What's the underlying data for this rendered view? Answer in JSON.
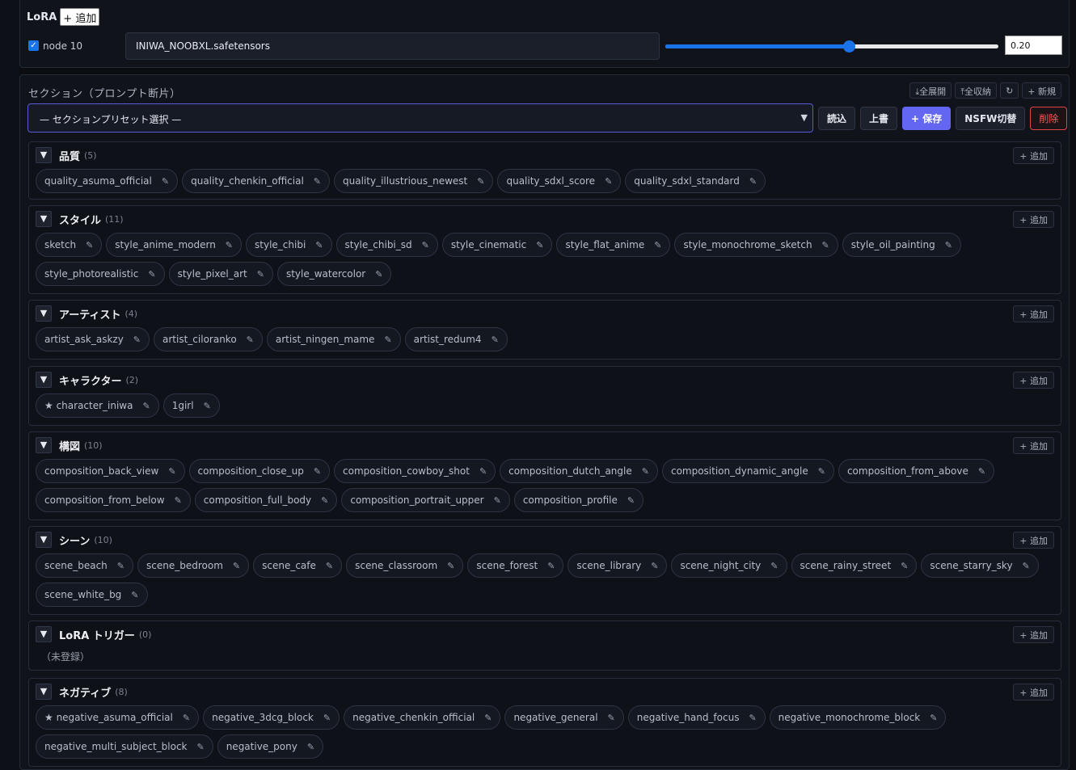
{
  "lora": {
    "title": "LoRA",
    "add_label": "+ 追加",
    "node_checked": true,
    "node_label": "node 10",
    "file": "INIWA_NOOBXL.safetensors",
    "slider_fraction": 0.55,
    "weight": "0.20"
  },
  "sections": {
    "heading": "セクション（プロンプト断片）",
    "tools": {
      "expand_all": "⤓全展開",
      "collapse_all": "⤒全収納",
      "refresh": "↻",
      "new": "+ 新規"
    },
    "preset_placeholder": "— セクションプリセット選択 —",
    "actions": {
      "load": "読込",
      "overwrite": "上書",
      "save": "+ 保存",
      "nsfw": "NSFW切替",
      "delete": "削除"
    },
    "toggle_glyph": "▼",
    "add_label": "+ 追加",
    "pen_glyph": "✎",
    "categories": [
      {
        "name": "品質",
        "count": "(5)",
        "tags": [
          "quality_asuma_official",
          "quality_chenkin_official",
          "quality_illustrious_newest",
          "quality_sdxl_score",
          "quality_sdxl_standard"
        ]
      },
      {
        "name": "スタイル",
        "count": "(11)",
        "tags": [
          "sketch",
          "style_anime_modern",
          "style_chibi",
          "style_chibi_sd",
          "style_cinematic",
          "style_flat_anime",
          "style_monochrome_sketch",
          "style_oil_painting",
          "style_photorealistic",
          "style_pixel_art",
          "style_watercolor"
        ]
      },
      {
        "name": "アーティスト",
        "count": "(4)",
        "tags": [
          "artist_ask_askzy",
          "artist_ciloranko",
          "artist_ningen_mame",
          "artist_redum4"
        ]
      },
      {
        "name": "キャラクター",
        "count": "(2)",
        "tags": [
          "★ character_iniwa",
          "1girl"
        ]
      },
      {
        "name": "構図",
        "count": "(10)",
        "tags": [
          "composition_back_view",
          "composition_close_up",
          "composition_cowboy_shot",
          "composition_dutch_angle",
          "composition_dynamic_angle",
          "composition_from_above",
          "composition_from_below",
          "composition_full_body",
          "composition_portrait_upper",
          "composition_profile"
        ]
      },
      {
        "name": "シーン",
        "count": "(10)",
        "tags": [
          "scene_beach",
          "scene_bedroom",
          "scene_cafe",
          "scene_classroom",
          "scene_forest",
          "scene_library",
          "scene_night_city",
          "scene_rainy_street",
          "scene_starry_sky",
          "scene_white_bg"
        ]
      },
      {
        "name": "LoRA トリガー",
        "count": "(0)",
        "tags": [],
        "empty_text": "（未登録）"
      },
      {
        "name": "ネガティブ",
        "count": "(8)",
        "tags": [
          "★ negative_asuma_official",
          "negative_3dcg_block",
          "negative_chenkin_official",
          "negative_general",
          "negative_hand_focus",
          "negative_monochrome_block",
          "negative_multi_subject_block",
          "negative_pony"
        ]
      }
    ]
  },
  "colors": {
    "accent": "#6366f1",
    "slider": "#1a73e8",
    "danger": "#ff5a5a"
  }
}
